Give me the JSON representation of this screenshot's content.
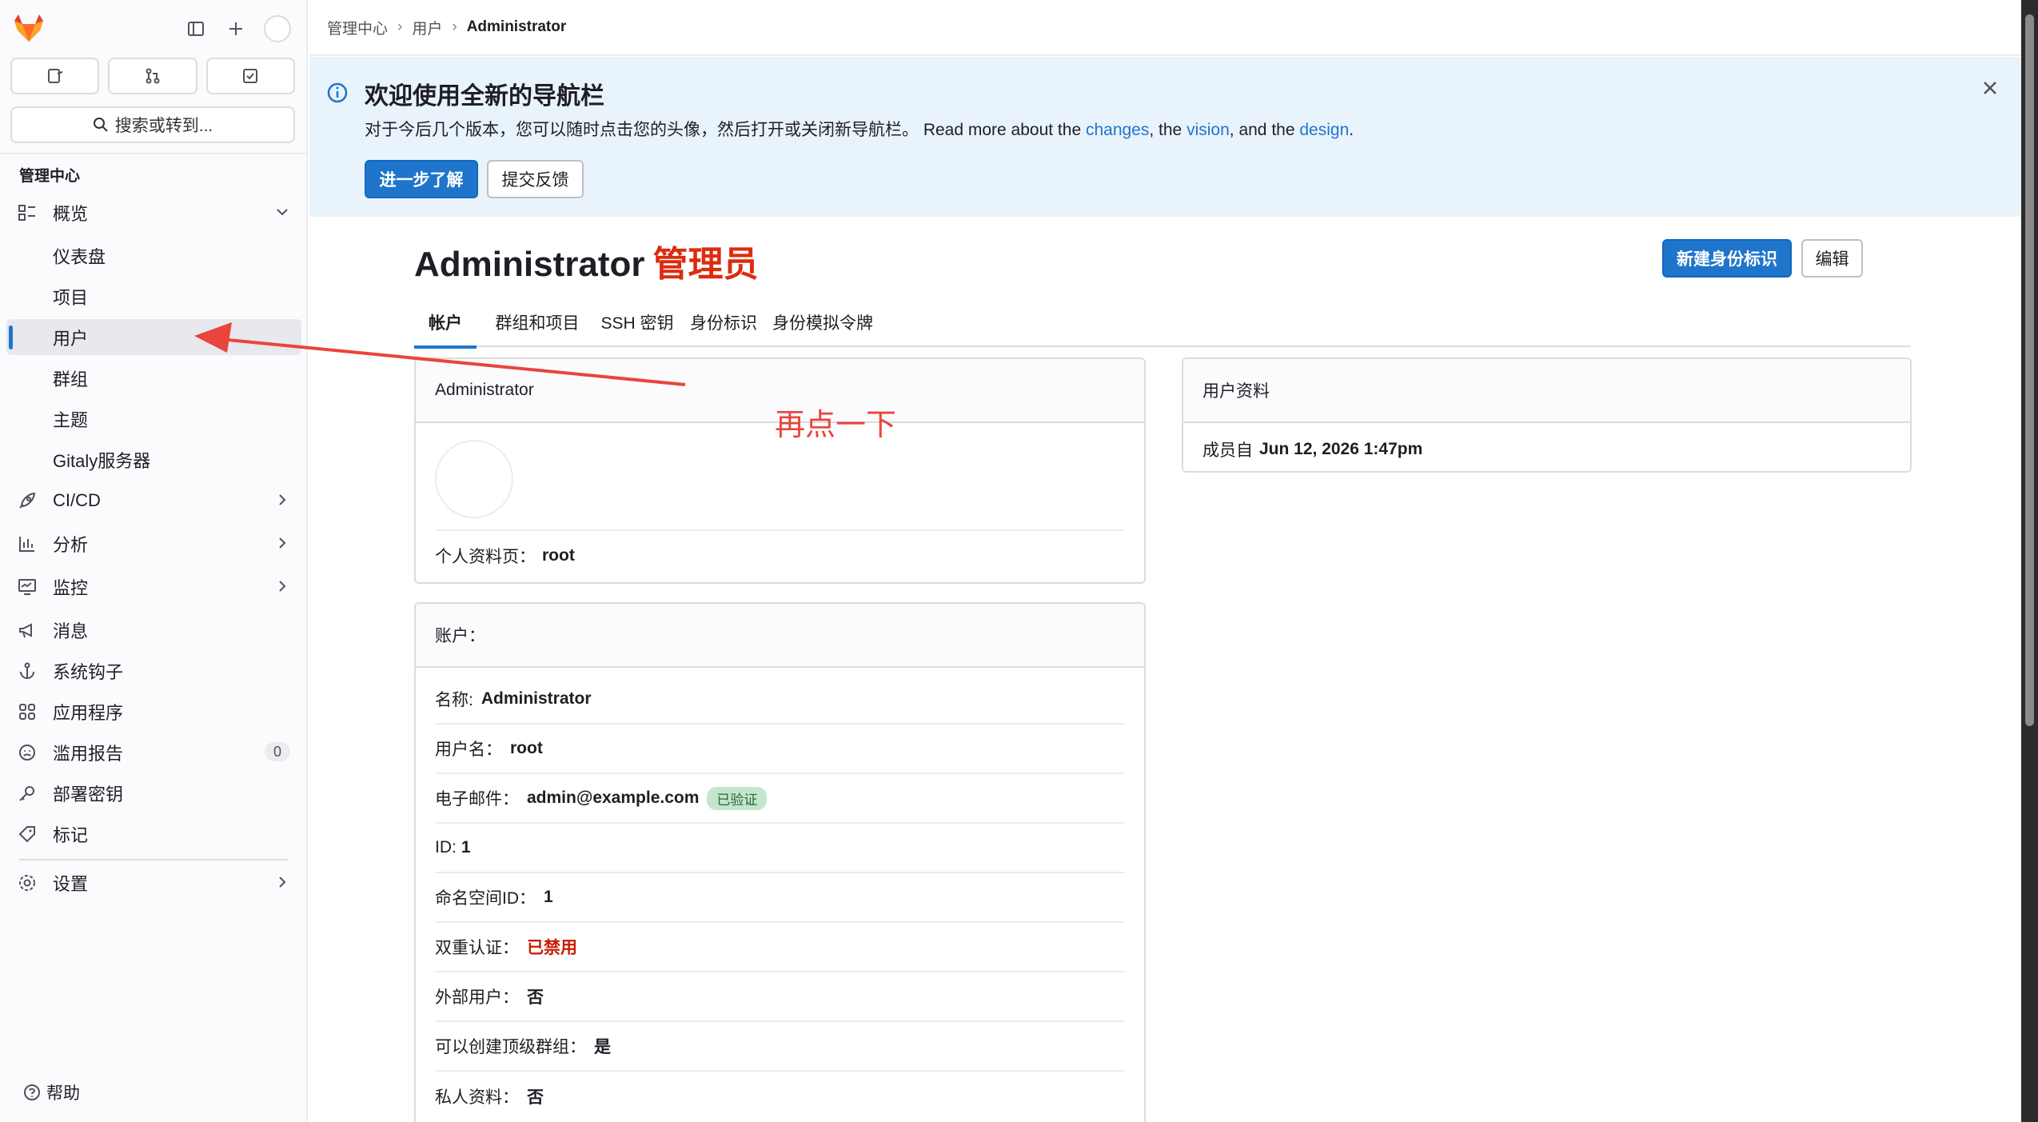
{
  "sidebar": {
    "search_label": "搜索或转到...",
    "section_title": "管理中心",
    "items": [
      {
        "label": "概览",
        "icon": "overview-icon"
      },
      {
        "label": "仪表盘"
      },
      {
        "label": "项目"
      },
      {
        "label": "用户"
      },
      {
        "label": "群组"
      },
      {
        "label": "主题"
      },
      {
        "label": "Gitaly服务器"
      },
      {
        "label": "CI/CD",
        "icon": "rocket-icon"
      },
      {
        "label": "分析",
        "icon": "chart-icon"
      },
      {
        "label": "监控",
        "icon": "monitor-icon"
      },
      {
        "label": "消息",
        "icon": "bullhorn-icon"
      },
      {
        "label": "系统钩子",
        "icon": "anchor-icon"
      },
      {
        "label": "应用程序",
        "icon": "apps-icon"
      },
      {
        "label": "滥用报告",
        "icon": "abuse-icon",
        "count": "0"
      },
      {
        "label": "部署密钥",
        "icon": "key-icon"
      },
      {
        "label": "标记",
        "icon": "label-icon"
      },
      {
        "label": "设置",
        "icon": "settings-icon"
      }
    ],
    "help_label": "帮助"
  },
  "breadcrumb": {
    "items": [
      "管理中心",
      "用户",
      "Administrator"
    ]
  },
  "banner": {
    "title": "欢迎使用全新的导航栏",
    "text_prefix": "对于今后几个版本，您可以随时点击您的头像，然后打开或关闭新导航栏。 Read more about the ",
    "link_changes": "changes",
    "text_mid1": ", the ",
    "link_vision": "vision",
    "text_mid2": ", and the ",
    "link_design": "design",
    "text_end": ".",
    "learn_more": "进一步了解",
    "feedback": "提交反馈"
  },
  "header": {
    "name": "Administrator",
    "role": "管理员",
    "new_identity": "新建身份标识",
    "edit": "编辑"
  },
  "tabs": [
    "帐户",
    "群组和项目",
    "SSH 密钥",
    "身份标识",
    "身份模拟令牌"
  ],
  "profile_card": {
    "title": "Administrator",
    "profile_page_label": "个人资料页：",
    "profile_page_value": "root"
  },
  "account_card": {
    "title": "账户：",
    "rows": {
      "name_label": "名称:",
      "name_value": "Administrator",
      "username_label": "用户名：",
      "username_value": "root",
      "email_label": "电子邮件：",
      "email_value": "admin@example.com",
      "verified": "已验证",
      "id_label": "ID:",
      "id_value": "1",
      "ns_label": "命名空间ID：",
      "ns_value": "1",
      "twofa_label": "双重认证：",
      "twofa_value": "已禁用",
      "external_label": "外部用户：",
      "external_value": "否",
      "create_group_label": "可以创建顶级群组：",
      "create_group_value": "是",
      "private_label": "私人资料：",
      "private_value": "否"
    }
  },
  "user_info_card": {
    "title": "用户资料",
    "member_label": "成员自",
    "member_value": "Jun 12, 2026 1:47pm"
  },
  "annotation": {
    "text": "再点一下",
    "color": "#e8453c"
  }
}
